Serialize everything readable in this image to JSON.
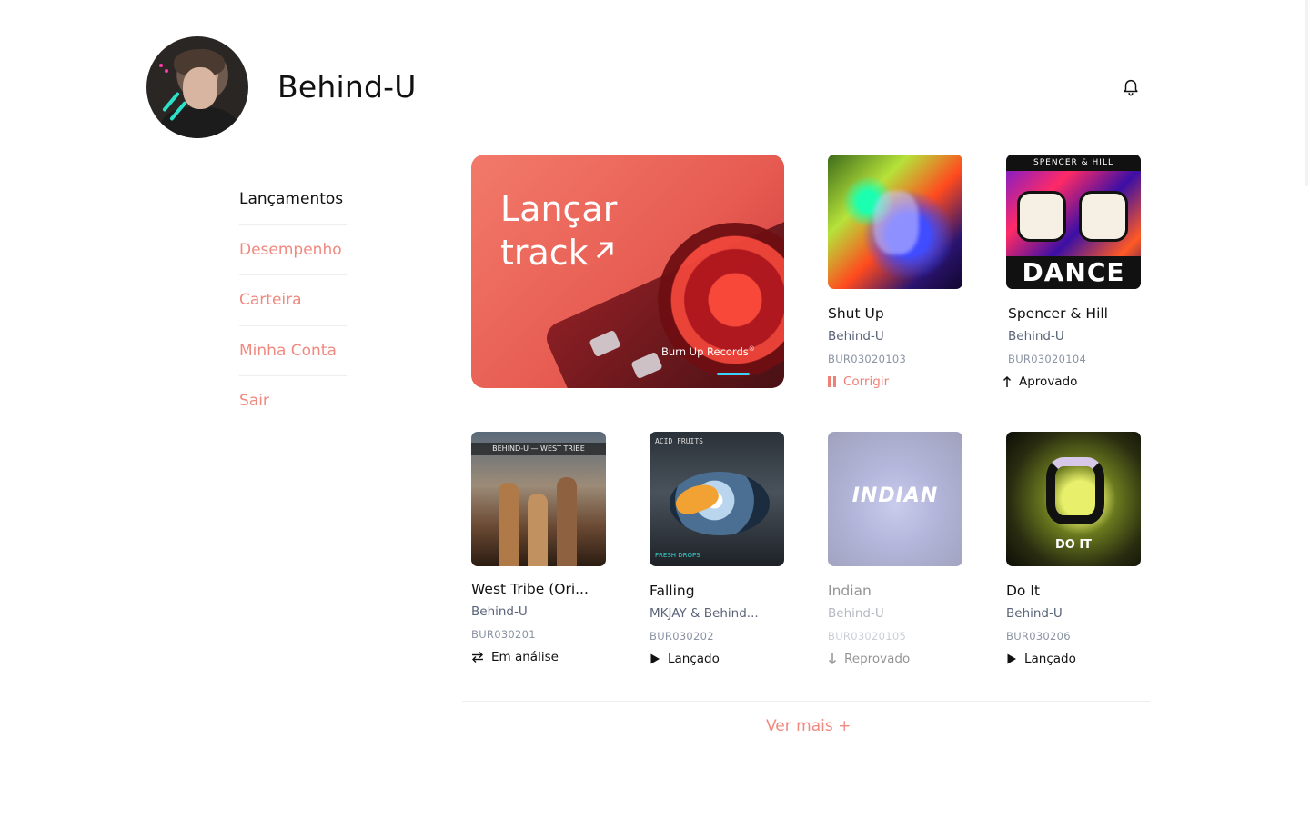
{
  "profile": {
    "name": "Behind-U"
  },
  "sidebar": {
    "items": [
      {
        "label": "Lançamentos"
      },
      {
        "label": "Desempenho"
      },
      {
        "label": "Carteira"
      },
      {
        "label": "Minha Conta"
      },
      {
        "label": "Sair"
      }
    ]
  },
  "hero": {
    "title_line1": "Lançar",
    "title_line2": "track",
    "label": "Burn Up Records",
    "label_mark": "®"
  },
  "tracks": [
    {
      "title": "Shut Up",
      "artist": "Behind-U",
      "code": "BUR03020103",
      "status": "Corrigir"
    },
    {
      "title": "Spencer & Hill",
      "artist": "Behind-U",
      "code": "BUR03020104",
      "status": "Aprovado"
    },
    {
      "title": "West Tribe (Ori...",
      "artist": "Behind-U",
      "code": "BUR030201",
      "status": "Em análise"
    },
    {
      "title": "Falling",
      "artist": "MKJAY & Behind...",
      "code": "BUR030202",
      "status": "Lançado"
    },
    {
      "title": "Indian",
      "artist": "Behind-U",
      "code": "BUR03020105",
      "status": "Reprovado"
    },
    {
      "title": "Do It",
      "artist": "Behind-U",
      "code": "BUR030206",
      "status": "Lançado"
    }
  ],
  "covers": {
    "spencer_top": "SPENCER & HILL",
    "spencer_word": "DANCE",
    "west_bar": "BEHIND-U — WEST TRIBE",
    "falling_text": "ACID FRUITS",
    "falling_label": "FRESH DROPS",
    "indian_word": "INDIAN",
    "doit_word": "DO IT"
  },
  "footer": {
    "more_label": "Ver mais +"
  },
  "colors": {
    "accent": "#f08a80",
    "text": "#111111",
    "muted": "#5a6478"
  }
}
